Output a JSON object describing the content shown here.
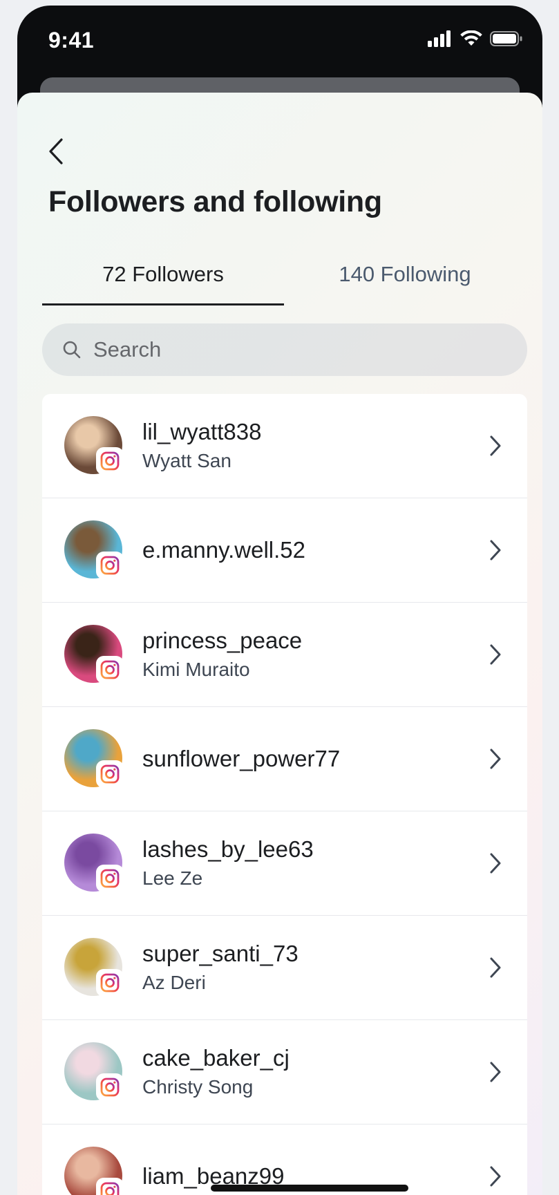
{
  "status_bar": {
    "time": "9:41",
    "icons": [
      "signal-icon",
      "wifi-icon",
      "battery-icon"
    ]
  },
  "header": {
    "back_icon": "chevron-left-icon",
    "title": "Followers and following"
  },
  "tabs": [
    {
      "label": "72 Followers",
      "active": true
    },
    {
      "label": "140 Following",
      "active": false
    }
  ],
  "search": {
    "placeholder": "Search",
    "value": "",
    "icon": "search-icon"
  },
  "list": {
    "items": [
      {
        "username": "lil_wyatt838",
        "fullname": "Wyatt San",
        "badge": "instagram-icon",
        "avatar_colors": [
          "#6b4a38",
          "#e8c8a8"
        ]
      },
      {
        "username": "e.manny.well.52",
        "fullname": "",
        "badge": "instagram-icon",
        "avatar_colors": [
          "#5ab6d6",
          "#7a5a3a"
        ]
      },
      {
        "username": "princess_peace",
        "fullname": "Kimi Muraito",
        "badge": "instagram-icon",
        "avatar_colors": [
          "#d94a7e",
          "#3a2418"
        ]
      },
      {
        "username": "sunflower_power77",
        "fullname": "",
        "badge": "instagram-icon",
        "avatar_colors": [
          "#e9a23b",
          "#4fa8c8"
        ]
      },
      {
        "username": "lashes_by_lee63",
        "fullname": "Lee Ze",
        "badge": "instagram-icon",
        "avatar_colors": [
          "#b58ad8",
          "#7a4aa0"
        ]
      },
      {
        "username": "super_santi_73",
        "fullname": "Az Deri",
        "badge": "instagram-icon",
        "avatar_colors": [
          "#e7e4de",
          "#c8a43a"
        ]
      },
      {
        "username": "cake_baker_cj",
        "fullname": "Christy Song",
        "badge": "instagram-icon",
        "avatar_colors": [
          "#9cc7c4",
          "#f1d9e1"
        ]
      },
      {
        "username": "liam_beanz99",
        "fullname": "",
        "badge": "instagram-icon",
        "avatar_colors": [
          "#a84a3e",
          "#e8b8a0"
        ]
      }
    ]
  },
  "colors": {
    "text_primary": "#1c1e21",
    "text_secondary": "#3e4652",
    "tab_inactive": "#4b5a6e",
    "instagram_gradient": [
      "#fcaf45",
      "#f56040",
      "#e1306c",
      "#833ab4"
    ]
  }
}
